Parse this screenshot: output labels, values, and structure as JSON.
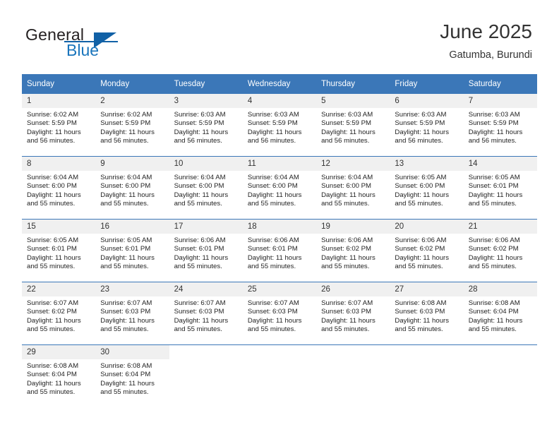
{
  "brand": {
    "name_part1": "General",
    "name_part2": "Blue",
    "logo_icon": "blue-triangle-icon"
  },
  "header": {
    "title": "June 2025",
    "location": "Gatumba, Burundi"
  },
  "calendar": {
    "weekday_headers": [
      "Sunday",
      "Monday",
      "Tuesday",
      "Wednesday",
      "Thursday",
      "Friday",
      "Saturday"
    ],
    "accent_color": "#3b77b8",
    "daynum_bg": "#f0f0f0",
    "weeks": [
      [
        {
          "day": "1",
          "sunrise": "Sunrise: 6:02 AM",
          "sunset": "Sunset: 5:59 PM",
          "daylight": "Daylight: 11 hours and 56 minutes."
        },
        {
          "day": "2",
          "sunrise": "Sunrise: 6:02 AM",
          "sunset": "Sunset: 5:59 PM",
          "daylight": "Daylight: 11 hours and 56 minutes."
        },
        {
          "day": "3",
          "sunrise": "Sunrise: 6:03 AM",
          "sunset": "Sunset: 5:59 PM",
          "daylight": "Daylight: 11 hours and 56 minutes."
        },
        {
          "day": "4",
          "sunrise": "Sunrise: 6:03 AM",
          "sunset": "Sunset: 5:59 PM",
          "daylight": "Daylight: 11 hours and 56 minutes."
        },
        {
          "day": "5",
          "sunrise": "Sunrise: 6:03 AM",
          "sunset": "Sunset: 5:59 PM",
          "daylight": "Daylight: 11 hours and 56 minutes."
        },
        {
          "day": "6",
          "sunrise": "Sunrise: 6:03 AM",
          "sunset": "Sunset: 5:59 PM",
          "daylight": "Daylight: 11 hours and 56 minutes."
        },
        {
          "day": "7",
          "sunrise": "Sunrise: 6:03 AM",
          "sunset": "Sunset: 5:59 PM",
          "daylight": "Daylight: 11 hours and 56 minutes."
        }
      ],
      [
        {
          "day": "8",
          "sunrise": "Sunrise: 6:04 AM",
          "sunset": "Sunset: 6:00 PM",
          "daylight": "Daylight: 11 hours and 55 minutes."
        },
        {
          "day": "9",
          "sunrise": "Sunrise: 6:04 AM",
          "sunset": "Sunset: 6:00 PM",
          "daylight": "Daylight: 11 hours and 55 minutes."
        },
        {
          "day": "10",
          "sunrise": "Sunrise: 6:04 AM",
          "sunset": "Sunset: 6:00 PM",
          "daylight": "Daylight: 11 hours and 55 minutes."
        },
        {
          "day": "11",
          "sunrise": "Sunrise: 6:04 AM",
          "sunset": "Sunset: 6:00 PM",
          "daylight": "Daylight: 11 hours and 55 minutes."
        },
        {
          "day": "12",
          "sunrise": "Sunrise: 6:04 AM",
          "sunset": "Sunset: 6:00 PM",
          "daylight": "Daylight: 11 hours and 55 minutes."
        },
        {
          "day": "13",
          "sunrise": "Sunrise: 6:05 AM",
          "sunset": "Sunset: 6:00 PM",
          "daylight": "Daylight: 11 hours and 55 minutes."
        },
        {
          "day": "14",
          "sunrise": "Sunrise: 6:05 AM",
          "sunset": "Sunset: 6:01 PM",
          "daylight": "Daylight: 11 hours and 55 minutes."
        }
      ],
      [
        {
          "day": "15",
          "sunrise": "Sunrise: 6:05 AM",
          "sunset": "Sunset: 6:01 PM",
          "daylight": "Daylight: 11 hours and 55 minutes."
        },
        {
          "day": "16",
          "sunrise": "Sunrise: 6:05 AM",
          "sunset": "Sunset: 6:01 PM",
          "daylight": "Daylight: 11 hours and 55 minutes."
        },
        {
          "day": "17",
          "sunrise": "Sunrise: 6:06 AM",
          "sunset": "Sunset: 6:01 PM",
          "daylight": "Daylight: 11 hours and 55 minutes."
        },
        {
          "day": "18",
          "sunrise": "Sunrise: 6:06 AM",
          "sunset": "Sunset: 6:01 PM",
          "daylight": "Daylight: 11 hours and 55 minutes."
        },
        {
          "day": "19",
          "sunrise": "Sunrise: 6:06 AM",
          "sunset": "Sunset: 6:02 PM",
          "daylight": "Daylight: 11 hours and 55 minutes."
        },
        {
          "day": "20",
          "sunrise": "Sunrise: 6:06 AM",
          "sunset": "Sunset: 6:02 PM",
          "daylight": "Daylight: 11 hours and 55 minutes."
        },
        {
          "day": "21",
          "sunrise": "Sunrise: 6:06 AM",
          "sunset": "Sunset: 6:02 PM",
          "daylight": "Daylight: 11 hours and 55 minutes."
        }
      ],
      [
        {
          "day": "22",
          "sunrise": "Sunrise: 6:07 AM",
          "sunset": "Sunset: 6:02 PM",
          "daylight": "Daylight: 11 hours and 55 minutes."
        },
        {
          "day": "23",
          "sunrise": "Sunrise: 6:07 AM",
          "sunset": "Sunset: 6:03 PM",
          "daylight": "Daylight: 11 hours and 55 minutes."
        },
        {
          "day": "24",
          "sunrise": "Sunrise: 6:07 AM",
          "sunset": "Sunset: 6:03 PM",
          "daylight": "Daylight: 11 hours and 55 minutes."
        },
        {
          "day": "25",
          "sunrise": "Sunrise: 6:07 AM",
          "sunset": "Sunset: 6:03 PM",
          "daylight": "Daylight: 11 hours and 55 minutes."
        },
        {
          "day": "26",
          "sunrise": "Sunrise: 6:07 AM",
          "sunset": "Sunset: 6:03 PM",
          "daylight": "Daylight: 11 hours and 55 minutes."
        },
        {
          "day": "27",
          "sunrise": "Sunrise: 6:08 AM",
          "sunset": "Sunset: 6:03 PM",
          "daylight": "Daylight: 11 hours and 55 minutes."
        },
        {
          "day": "28",
          "sunrise": "Sunrise: 6:08 AM",
          "sunset": "Sunset: 6:04 PM",
          "daylight": "Daylight: 11 hours and 55 minutes."
        }
      ],
      [
        {
          "day": "29",
          "sunrise": "Sunrise: 6:08 AM",
          "sunset": "Sunset: 6:04 PM",
          "daylight": "Daylight: 11 hours and 55 minutes."
        },
        {
          "day": "30",
          "sunrise": "Sunrise: 6:08 AM",
          "sunset": "Sunset: 6:04 PM",
          "daylight": "Daylight: 11 hours and 55 minutes."
        },
        null,
        null,
        null,
        null,
        null
      ]
    ]
  }
}
